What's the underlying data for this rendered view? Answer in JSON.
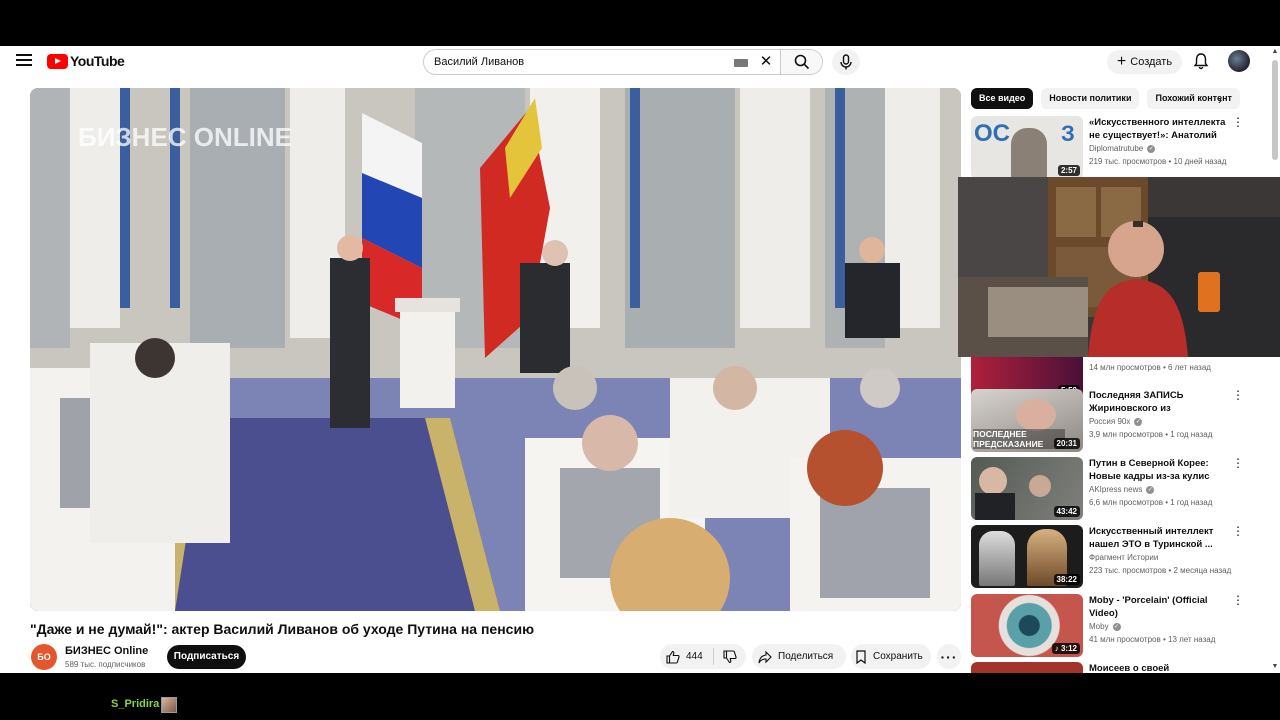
{
  "masthead": {
    "logo_text": "YouTube",
    "search_query": "Василий Ливанов",
    "create_label": "Создать"
  },
  "player": {
    "watermark": "БИЗНЕС ONLINE"
  },
  "video": {
    "title": "\"Даже и не думай!\": актер Василий Ливанов об уходе Путина на пенсию",
    "channel_avatar_text": "БО",
    "channel_name": "БИЗНЕС Online",
    "channel_subs": "589 тыс. подписчиков",
    "subscribe_label": "Подписаться",
    "likes": "444",
    "share_label": "Поделиться",
    "save_label": "Сохранить"
  },
  "chips": [
    "Все видео",
    "Новости политики",
    "Похожий контент"
  ],
  "recommendations": [
    {
      "title": "«Искусственного интеллекта не существует!»: Анатолий ...",
      "channel": "Diplomatrutube",
      "meta": "219 тыс. просмотров • 10 дней назад",
      "duration": "2:57",
      "thumb_text": "ОС"
    },
    {
      "title": "",
      "channel": "",
      "meta": "14 млн просмотров • 6 лет назад",
      "duration": "5:59",
      "thumb_text": ""
    },
    {
      "title": "Последняя ЗАПИСЬ Жириновского из больницы....",
      "channel": "Россия 90х",
      "meta": "3,9 млн просмотров • 1 год назад",
      "duration": "20:31",
      "thumb_text": "ПОСЛЕДНЕЕ ПРЕДСКАЗАНИЕ"
    },
    {
      "title": "Путин в Северной Корее: Новые кадры из-за кулис",
      "channel": "AKIpress news",
      "meta": "6,6 млн просмотров • 1 год назад",
      "duration": "43:42",
      "thumb_text": ""
    },
    {
      "title": "Искусственный интеллект нашел ЭТО в Туринской ...",
      "channel": "Фрагмент Истории",
      "meta": "223 тыс. просмотров • 2 месяца назад",
      "duration": "38:22",
      "thumb_text": ""
    },
    {
      "title": "Moby - 'Porcelain' (Official Video)",
      "channel": "Moby",
      "meta": "41 млн просмотров • 13 лет назад",
      "duration": "3:12",
      "thumb_text": ""
    },
    {
      "title": "Моисеев о своей",
      "channel": "",
      "meta": "",
      "duration": "",
      "thumb_text": ""
    }
  ],
  "overlay": {
    "streamer_name": "S_Pridira"
  },
  "colors": {
    "brand_red": "#ff0000",
    "subscribe_bg": "#0f0f0f",
    "channel_avatar": "#e4572e",
    "streamer_green": "#8bd34a"
  }
}
